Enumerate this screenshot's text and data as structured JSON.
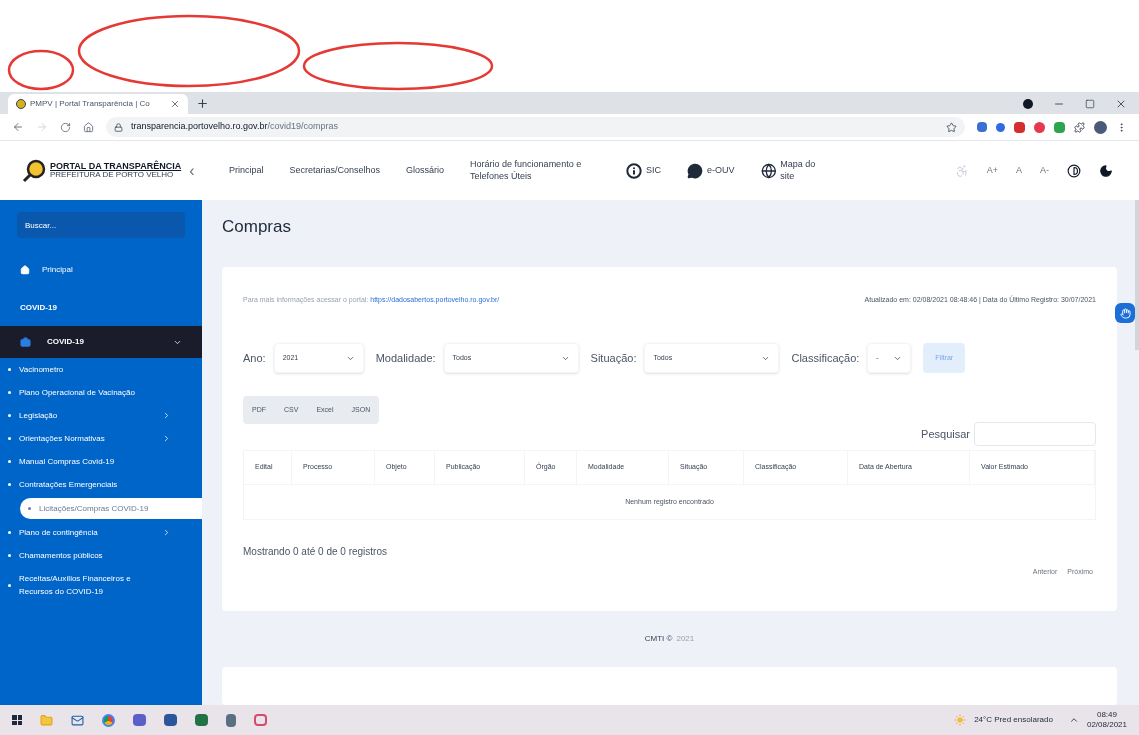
{
  "browser": {
    "tab_title": "PMPV | Portal Transparência | Co",
    "url_host": "transparencia.portovelho.ro.gov.br",
    "url_path": "/covid19/compras"
  },
  "header": {
    "logo_title": "PORTAL DA TRANSPARÊNCIA",
    "logo_subtitle": "PREFEITURA DE PORTO VELHO",
    "collapse": "‹",
    "nav": [
      {
        "label": "Principal",
        "kind": "link"
      },
      {
        "label": "Secretarias/Conselhos",
        "kind": "link"
      },
      {
        "label": "Glossário",
        "kind": "link"
      },
      {
        "label": "Horário de funcionamento e Telefones Úteis",
        "kind": "link"
      },
      {
        "label": "SIC",
        "kind": "icon_link"
      },
      {
        "label": "e-OUV",
        "kind": "icon_link"
      },
      {
        "label": "Mapa do site",
        "kind": "icon_link"
      }
    ],
    "font_buttons": [
      "A+",
      "A",
      "A-"
    ]
  },
  "sidebar": {
    "search_placeholder": "Buscar...",
    "home": "Principal",
    "section": "COVID-19",
    "group": {
      "label": "COVID-19",
      "expanded": true,
      "items": [
        {
          "label": "Vacinometro",
          "kind": "link",
          "selected": false
        },
        {
          "label": "Plano Operacional de Vacinação",
          "kind": "link",
          "selected": false
        },
        {
          "label": "Legislação",
          "kind": "submenu",
          "selected": false
        },
        {
          "label": "Orientações Normativas",
          "kind": "submenu",
          "selected": false
        },
        {
          "label": "Manual Compras Covid-19",
          "kind": "link",
          "selected": false
        },
        {
          "label": "Contratações Emergenciais",
          "kind": "link",
          "selected": false
        },
        {
          "label": "Licitações/Compras COVID-19",
          "kind": "link",
          "selected": true
        },
        {
          "label": "Plano de contingência",
          "kind": "submenu",
          "selected": false
        },
        {
          "label": "Chamamentos públicos",
          "kind": "link",
          "selected": false
        },
        {
          "label": "Receitas/Auxílios Financeiros e Recursos do COVID-19",
          "kind": "link",
          "selected": false
        }
      ]
    }
  },
  "page": {
    "title": "Compras",
    "info_text": "Para mais informações acessar o portal:",
    "info_link": "https://dadosabertos.portovelho.ro.gov.br/",
    "updated": "Atualizado em: 02/08/2021 08:48:46 | Data do Último Registro: 30/07/2021",
    "filters": [
      {
        "label": "Ano:",
        "value": "2021"
      },
      {
        "label": "Modalidade:",
        "value": "Todos"
      },
      {
        "label": "Situação:",
        "value": "Todos"
      },
      {
        "label": "Classificação:",
        "value": "-"
      }
    ],
    "filter_button": "Filtrar",
    "exports": [
      "PDF",
      "CSV",
      "Excel",
      "JSON"
    ],
    "search_label": "Pesquisar",
    "table": {
      "columns": [
        "Edital",
        "Processo",
        "Objeto",
        "Publicação",
        "Órgão",
        "Modalidade",
        "Situação",
        "Classificação",
        "Data de Abertura",
        "Valor Estimado"
      ],
      "empty": "Nenhum registro encontrado"
    },
    "showing": "Mostrando 0 até 0 de 0 registros",
    "pagination": [
      {
        "label": "Anterior",
        "disabled": true
      },
      {
        "label": "Próximo",
        "disabled": true
      }
    ],
    "footer": {
      "text": "CMTI ©",
      "year": "2021"
    }
  },
  "taskbar": {
    "weather": "24°C Pred ensolarado",
    "time": "08:49",
    "date": "02/08/2021"
  }
}
